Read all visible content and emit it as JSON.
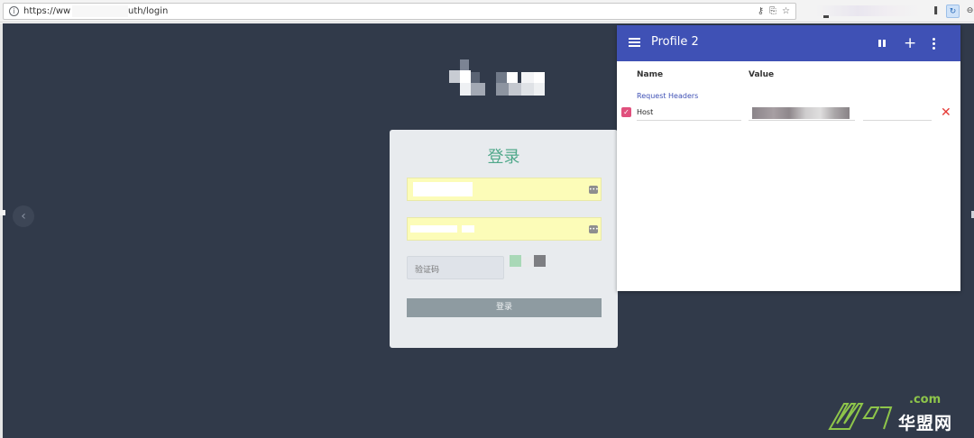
{
  "browser": {
    "url_prefix": "https://ww",
    "url_path": "uth/login",
    "omnibox_icons": [
      "key-icon",
      "translate-icon",
      "star-icon"
    ],
    "extensions": [
      "extension-icon",
      "modheader-icon",
      "profile-icon"
    ]
  },
  "login": {
    "title": "登录",
    "captcha_placeholder": "验证码",
    "submit_label": "登录",
    "title_color": "#4fa88a",
    "autofill_color": "#fcfcb8"
  },
  "modheader": {
    "profile_title": "Profile 2",
    "columns": {
      "name": "Name",
      "value": "Value"
    },
    "section_label": "Request Headers",
    "headers": [
      {
        "enabled": true,
        "name": "Host"
      }
    ],
    "bar_color": "#3f51b5",
    "checkbox_color": "#e0507d"
  },
  "watermark": {
    "domain_suffix": ".com",
    "brand_name": "华盟网"
  },
  "colors": {
    "page_background": "#313a4a",
    "delete_color": "#e53935"
  }
}
